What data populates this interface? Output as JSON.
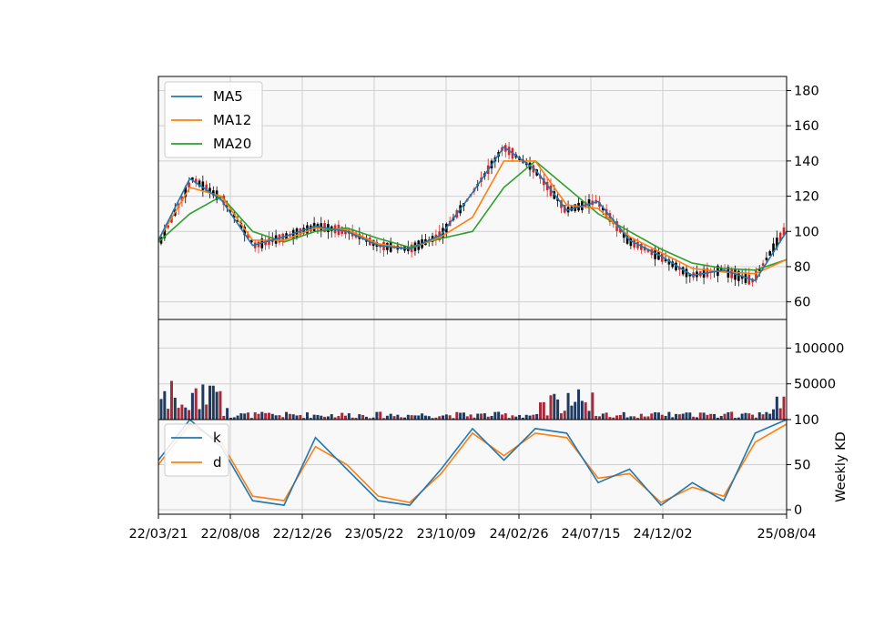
{
  "colors": {
    "ma5": "#1f77b4",
    "ma12": "#ff7f0e",
    "ma20": "#2ca02c",
    "k": "#1f77b4",
    "d": "#ff7f0e",
    "candle_up": "#d62728",
    "candle_down": "#000000",
    "vol_up": "#a52a3a",
    "vol_down": "#1f3a5f",
    "panel_bg": "#f8f8f8",
    "grid": "#d0d0d0"
  },
  "chart_data": [
    {
      "type": "candlestick",
      "panel": "price",
      "ylim": [
        50,
        188
      ],
      "yticks": [
        "60",
        "80",
        "100",
        "120",
        "140",
        "160",
        "180"
      ],
      "grid": true,
      "legend_position": "top-left",
      "x": [
        "22/03/21",
        "22/08/08",
        "22/12/26",
        "23/05/22",
        "23/10/09",
        "24/02/26",
        "24/07/15",
        "24/12/02",
        "25/08/04"
      ],
      "series": [
        {
          "name": "MA5",
          "close_approx": [
            95,
            130,
            118,
            92,
            97,
            103,
            100,
            92,
            90,
            98,
            122,
            148,
            135,
            112,
            117,
            95,
            86,
            75,
            78,
            72,
            100
          ]
        },
        {
          "name": "MA12",
          "close_approx": [
            95,
            125,
            120,
            95,
            95,
            102,
            101,
            93,
            90,
            97,
            108,
            140,
            140,
            115,
            113,
            97,
            88,
            79,
            77,
            76,
            84
          ]
        },
        {
          "name": "MA20",
          "close_approx": [
            94,
            110,
            120,
            100,
            94,
            100,
            102,
            96,
            91,
            96,
            100,
            125,
            140,
            125,
            110,
            100,
            90,
            82,
            79,
            78,
            84
          ]
        }
      ]
    },
    {
      "type": "bar",
      "panel": "volume",
      "ylim": [
        0,
        140000
      ],
      "yticks": [
        "50000",
        "100000"
      ],
      "grid": true
    },
    {
      "type": "line",
      "panel": "kd",
      "ylabel": "Weekly KD",
      "ylim": [
        -5,
        100
      ],
      "yticks": [
        "0",
        "50",
        "100"
      ],
      "grid": true,
      "legend_position": "top-left",
      "x": [
        "22/03/21",
        "22/08/08",
        "22/12/26",
        "23/05/22",
        "23/10/09",
        "24/02/26",
        "24/07/15",
        "24/12/02",
        "25/08/04"
      ],
      "series": [
        {
          "name": "k",
          "values": [
            55,
            100,
            70,
            10,
            5,
            80,
            45,
            10,
            5,
            45,
            90,
            55,
            90,
            85,
            30,
            45,
            5,
            30,
            10,
            85,
            100
          ]
        },
        {
          "name": "d",
          "values": [
            50,
            95,
            75,
            15,
            10,
            70,
            50,
            15,
            8,
            40,
            85,
            60,
            85,
            80,
            35,
            40,
            8,
            25,
            15,
            75,
            95
          ]
        }
      ]
    }
  ]
}
